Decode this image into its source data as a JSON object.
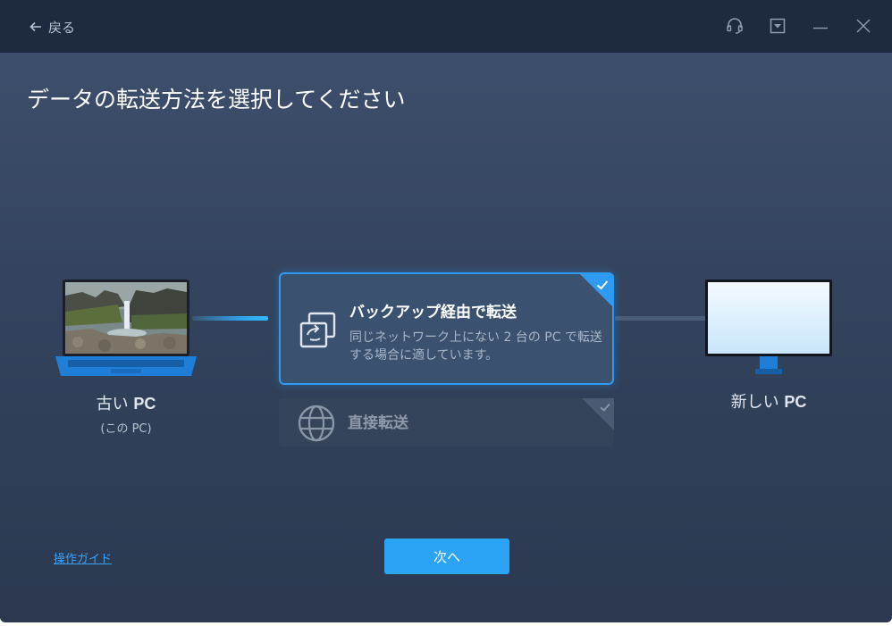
{
  "titlebar": {
    "back_label": "戻る",
    "icons": [
      "headset-icon",
      "dropdown-box-icon",
      "minimize-icon",
      "close-icon"
    ]
  },
  "heading": "データの転送方法を選択してください",
  "old_pc": {
    "label_prefix": "古い",
    "label_pc": "PC",
    "sub": "(この PC)"
  },
  "new_pc": {
    "label_prefix": "新しい",
    "label_pc": "PC"
  },
  "options": [
    {
      "title": "バックアップ経由で転送",
      "desc": "同じネットワーク上にない 2 台の PC で転送する場合に適しています。",
      "selected": true,
      "icon": "backup-transfer-icon"
    },
    {
      "title": "直接転送",
      "selected": false,
      "icon": "globe-icon"
    }
  ],
  "footer": {
    "guide_link": "操作ガイド",
    "next_button": "次へ"
  },
  "colors": {
    "accent": "#2e9bf2",
    "titlebar_bg": "#1d2a3f",
    "window_bg": "#3a4a64"
  }
}
